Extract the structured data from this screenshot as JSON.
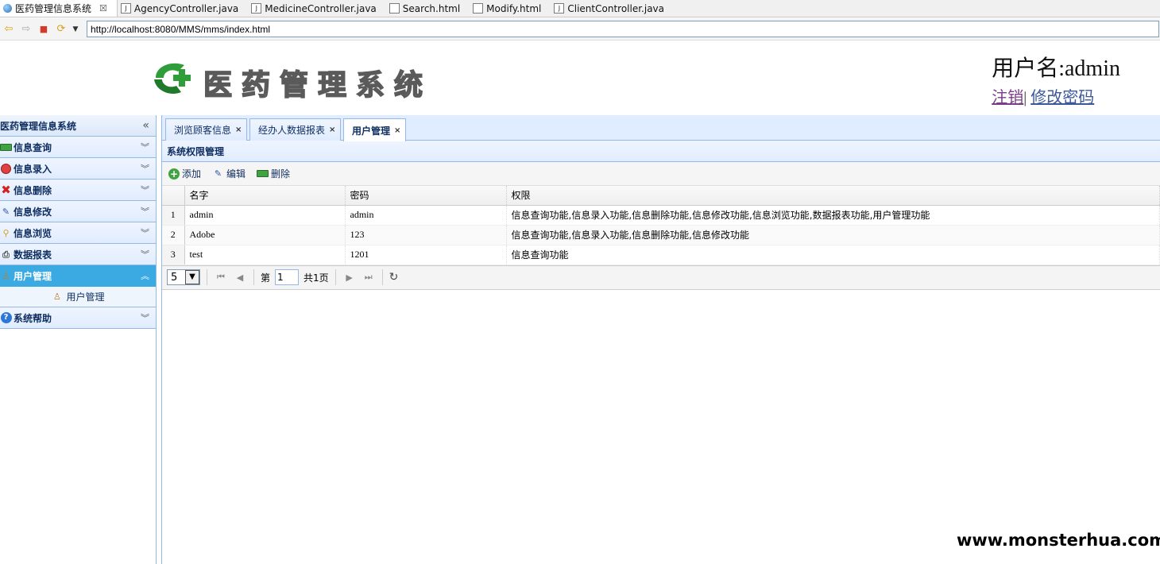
{
  "ide": {
    "tabs": [
      {
        "label": "医药管理信息系统",
        "icon": "globe-icon",
        "active": true,
        "close": "☒"
      },
      {
        "label": "AgencyController.java",
        "icon": "java-file-icon"
      },
      {
        "label": "MedicineController.java",
        "icon": "java-file-icon"
      },
      {
        "label": "Search.html",
        "icon": "html-file-icon"
      },
      {
        "label": "Modify.html",
        "icon": "html-file-icon"
      },
      {
        "label": "ClientController.java",
        "icon": "java-file-icon"
      }
    ]
  },
  "browser": {
    "url": "http://localhost:8080/MMS/mms/index.html"
  },
  "header": {
    "title": "医药管理系统",
    "user_label": "用户名:admin",
    "logout": "注销",
    "link_sep": "|",
    "change_password": "修改密码"
  },
  "sidebar": {
    "title": "医药管理信息系统",
    "collapse": "«",
    "items": [
      {
        "label": "信息查询",
        "icon": "minus-icon"
      },
      {
        "label": "信息录入",
        "icon": "no-entry-icon"
      },
      {
        "label": "信息删除",
        "icon": "delete-x-icon"
      },
      {
        "label": "信息修改",
        "icon": "pencil-icon"
      },
      {
        "label": "信息浏览",
        "icon": "magnifier-icon"
      },
      {
        "label": "数据报表",
        "icon": "printer-icon"
      },
      {
        "label": "用户管理",
        "icon": "user-icon",
        "selected": true
      },
      {
        "label": "系统帮助",
        "icon": "help-icon"
      }
    ],
    "sub_item": {
      "label": "用户管理",
      "icon": "user-icon"
    }
  },
  "tabs": [
    {
      "label": "浏览顾客信息"
    },
    {
      "label": "经办人数据报表"
    },
    {
      "label": "用户管理",
      "active": true
    }
  ],
  "panel": {
    "title": "系统权限管理"
  },
  "toolbar": {
    "add": "添加",
    "edit": "编辑",
    "delete": "删除"
  },
  "table": {
    "columns": [
      "名字",
      "密码",
      "权限"
    ],
    "rows": [
      {
        "no": "1",
        "name": "admin",
        "password": "admin",
        "permissions": "信息查询功能,信息录入功能,信息删除功能,信息修改功能,信息浏览功能,数据报表功能,用户管理功能"
      },
      {
        "no": "2",
        "name": "Adobe",
        "password": "123",
        "permissions": "信息查询功能,信息录入功能,信息删除功能,信息修改功能"
      },
      {
        "no": "3",
        "name": "test",
        "password": "1201",
        "permissions": "信息查询功能"
      }
    ]
  },
  "pager": {
    "page_size": "5",
    "page_label": "第",
    "page_value": "1",
    "total_label": "共1页"
  },
  "watermark": "www.monsterhua.com",
  "colors": {
    "accent": "#3baae3",
    "panel_border": "#95b8e7",
    "header_bg": "#e0ecff"
  }
}
